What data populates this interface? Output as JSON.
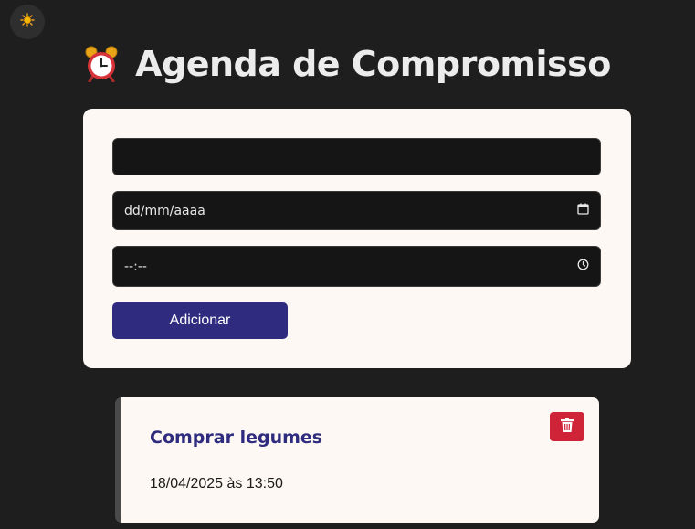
{
  "app": {
    "title": "Agenda de Compromisso",
    "title_icon": "alarm-clock-icon",
    "theme_toggle_icon": "sun-icon"
  },
  "form": {
    "task_input": {
      "value": "",
      "placeholder": ""
    },
    "date_input": {
      "display": "dd/mm/aaaa",
      "icon": "calendar-icon"
    },
    "time_input": {
      "display": "--:--",
      "icon": "clock-icon"
    },
    "add_button_label": "Adicionar"
  },
  "tasks": [
    {
      "title": "Comprar legumes",
      "datetime": "18/04/2025 às 13:50",
      "delete_icon": "trash-icon"
    }
  ],
  "colors": {
    "background": "#1e1e1e",
    "card": "#fdf8f3",
    "accent": "#2f2c80",
    "danger": "#cf2338",
    "input_bg": "#151515"
  }
}
